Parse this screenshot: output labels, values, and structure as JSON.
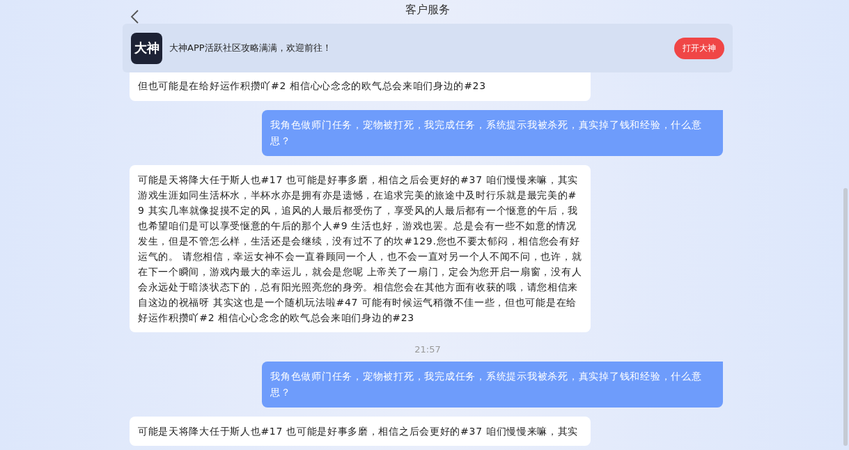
{
  "header": {
    "title": "客户服务"
  },
  "banner": {
    "app_icon_text": "大神",
    "text": "大神APP活跃社区攻略满满，欢迎前往！",
    "button": "打开大神"
  },
  "messages": [
    {
      "kind": "agent",
      "text": "但也可能是在给好运作积攒吖#2 相信心心念念的欧气总会来咱们身边的#23"
    },
    {
      "kind": "user",
      "text": "我角色做师门任务，宠物被打死，我完成任务，系统提示我被杀死，真实掉了钱和经验，什么意思？"
    },
    {
      "kind": "agent",
      "text": "可能是天将降大任于斯人也#17 也可能是好事多磨，相信之后会更好的#37 咱们慢慢来嘛，其实游戏生涯如同生活杯水，半杯水亦是拥有亦是遗憾，在追求完美的旅途中及时行乐就是最完美的#9 其实几率就像捉摸不定的风，追风的人最后都受伤了，享受风的人最后都有一个惬意的午后，我也希望咱们是可以享受惬意的午后的那个人#9 生活也好，游戏也罢。总是会有一些不如意的情况发生，但是不管怎么样，生活还是会继续，没有过不了的坎#129.您也不要太郁闷，相信您会有好运气的。 请您相信，幸运女神不会一直眷顾同一个人，也不会一直对另一个人不闻不问，也许，就在下一个瞬间，游戏内最大的幸运儿，就会是您呢 上帝关了一扇门，定会为您开启一扇窗，没有人会永远处于暗淡状态下的，总有阳光照亮您的身旁。相信您会在其他方面有收获的哦，请您相信来自这边的祝福呀 其实这也是一个随机玩法啦#47 可能有时候运气稍微不佳一些，但也可能是在给好运作积攒吖#2 相信心心念念的欧气总会来咱们身边的#23"
    },
    {
      "kind": "time",
      "text": "21:57"
    },
    {
      "kind": "user",
      "text": "我角色做师门任务，宠物被打死，我完成任务，系统提示我被杀死，真实掉了钱和经验，什么意思？"
    },
    {
      "kind": "agent",
      "text": "可能是天将降大任于斯人也#17 也可能是好事多磨，相信之后会更好的#37 咱们慢慢来嘛，其实"
    }
  ]
}
